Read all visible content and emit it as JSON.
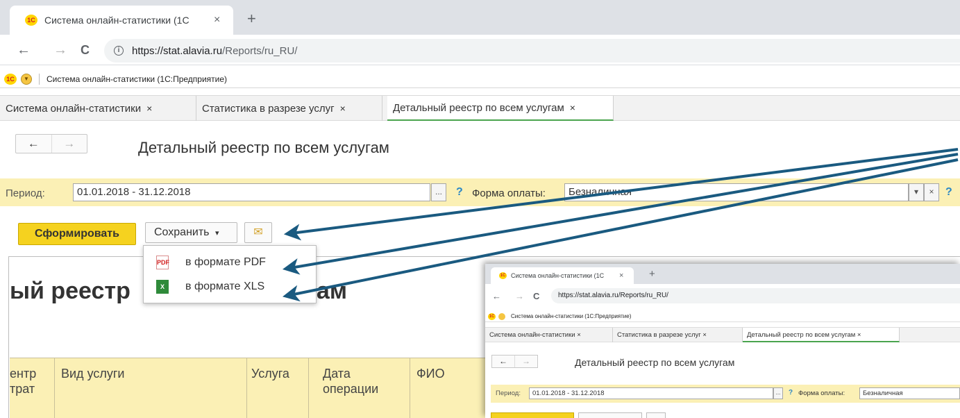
{
  "browser": {
    "tab_title": "Система онлайн-статистики (1С",
    "tab_close": "×",
    "new_tab": "+",
    "back": "←",
    "forward": "→",
    "reload": "C",
    "info": "i",
    "url_host": "https://stat.alavia.ru",
    "url_path": "/Reports/ru_RU/"
  },
  "app": {
    "logo": "1С",
    "title": "Система онлайн-статистики  (1С:Предприятие)"
  },
  "tabs": [
    {
      "label": "Система онлайн-статистики",
      "close": "×"
    },
    {
      "label": "Статистика в разрезе услуг",
      "close": "×"
    },
    {
      "label": "Детальный реестр по всем услугам",
      "close": "×"
    }
  ],
  "form": {
    "back": "←",
    "forward": "→",
    "title": "Детальный реестр по всем услугам"
  },
  "filter": {
    "period_label": "Период:",
    "period_value": "01.01.2018 - 31.12.2018",
    "dots": "...",
    "help": "?",
    "payment_label": "Форма оплаты:",
    "payment_value": "Безналичная",
    "dropdown": "▾",
    "clear": "×",
    "help2": "?"
  },
  "toolbar": {
    "generate": "Сформировать",
    "save": "Сохранить",
    "save_arrow": "▾",
    "mail": "✉"
  },
  "menu": {
    "items": [
      {
        "label": "в формате PDF",
        "icon": "pdf-file-icon",
        "glyph": "PDF"
      },
      {
        "label": "в формате XLS",
        "icon": "excel-file-icon",
        "glyph": "X"
      }
    ]
  },
  "report": {
    "title_partial": "ый реестр",
    "title_tail": "угам",
    "columns": [
      {
        "line1": "ентр",
        "line2": "трат"
      },
      {
        "line1": "Вид услуги",
        "line2": ""
      },
      {
        "line1": "Услуга",
        "line2": ""
      },
      {
        "line1": "Дата",
        "line2": "операции"
      },
      {
        "line1": "ФИО",
        "line2": ""
      }
    ]
  },
  "inset": {
    "tab_title": "Система онлайн-статистики (1С",
    "tab_close": "×",
    "new_tab": "+",
    "back": "←",
    "forward": "→",
    "reload": "C",
    "url": "https://stat.alavia.ru/Reports/ru_RU/",
    "app_logo": "1С",
    "app_title": "Система онлайн-статистики  (1С:Предприятие)",
    "tabs": [
      "Система онлайн-статистики  ×",
      "Статистика в разрезе услуг  ×",
      "Детальный реестр по всем услугам  ×"
    ],
    "form_back": "←",
    "form_forward": "→",
    "form_title": "Детальный реестр по всем услугам",
    "period_label": "Период:",
    "period_value": "01.01.2018 - 31.12.2018",
    "dots": "...",
    "help": "?",
    "payment_label": "Форма оплаты:",
    "payment_value": "Безналичная"
  },
  "colors": {
    "arrow": "#1a5a80",
    "yellow_panel": "#fbf0b5",
    "generate_button": "#f5d21f",
    "active_tab_underline": "#4aa44e"
  }
}
